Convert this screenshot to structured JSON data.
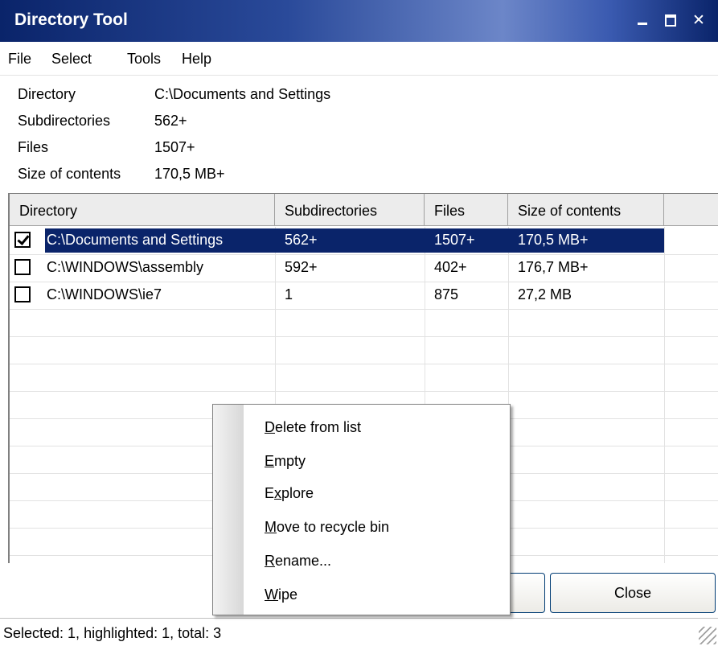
{
  "window": {
    "title": "Directory Tool"
  },
  "menu": [
    "File",
    "Select",
    "Tools",
    "Help"
  ],
  "info": [
    {
      "label": "Directory",
      "value": "C:\\Documents and Settings"
    },
    {
      "label": "Subdirectories",
      "value": "562+"
    },
    {
      "label": "Files",
      "value": "1507+"
    },
    {
      "label": "Size of contents",
      "value": "170,5 MB+"
    }
  ],
  "table": {
    "columns": [
      "Directory",
      "Subdirectories",
      "Files",
      "Size of contents"
    ],
    "rows": [
      {
        "checked": true,
        "selected": true,
        "cells": [
          "C:\\Documents and Settings",
          "562+",
          "1507+",
          "170,5 MB+"
        ]
      },
      {
        "checked": false,
        "selected": false,
        "cells": [
          "C:\\WINDOWS\\assembly",
          "592+",
          "402+",
          "176,7 MB+"
        ]
      },
      {
        "checked": false,
        "selected": false,
        "cells": [
          "C:\\WINDOWS\\ie7",
          "1",
          "875",
          "27,2 MB"
        ]
      }
    ]
  },
  "context_menu": [
    {
      "accel": "D",
      "rest": "elete from list"
    },
    {
      "accel": "E",
      "rest": "mpty"
    },
    {
      "pre": "E",
      "accel": "x",
      "rest": "plore"
    },
    {
      "accel": "M",
      "rest": "ove to recycle bin"
    },
    {
      "accel": "R",
      "rest": "ename..."
    },
    {
      "accel": "W",
      "rest": "ipe"
    }
  ],
  "buttons": {
    "close": "Close"
  },
  "status": "Selected: 1, highlighted: 1, total: 3"
}
